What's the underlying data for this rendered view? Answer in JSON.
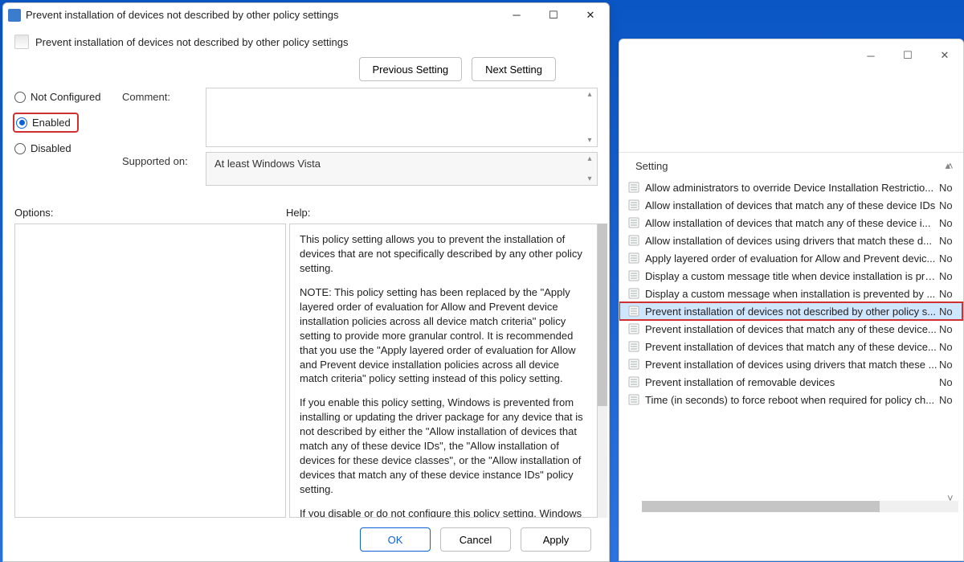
{
  "bg": {
    "header_setting": "Setting",
    "sort_indicator": "▴",
    "rows": [
      {
        "label": "Allow administrators to override Device Installation Restrictio...",
        "state": "No",
        "sel": false
      },
      {
        "label": "Allow installation of devices that match any of these device IDs",
        "state": "No",
        "sel": false
      },
      {
        "label": "Allow installation of devices that match any of these device i...",
        "state": "No",
        "sel": false
      },
      {
        "label": "Allow installation of devices using drivers that match these d...",
        "state": "No",
        "sel": false
      },
      {
        "label": "Apply layered order of evaluation for Allow and Prevent devic...",
        "state": "No",
        "sel": false
      },
      {
        "label": "Display a custom message title when device installation is pre...",
        "state": "No",
        "sel": false
      },
      {
        "label": "Display a custom message when installation is prevented by ...",
        "state": "No",
        "sel": false
      },
      {
        "label": "Prevent installation of devices not described by other policy s...",
        "state": "No",
        "sel": true
      },
      {
        "label": "Prevent installation of devices that match any of these device...",
        "state": "No",
        "sel": false
      },
      {
        "label": "Prevent installation of devices that match any of these device...",
        "state": "No",
        "sel": false
      },
      {
        "label": "Prevent installation of devices using drivers that match these ...",
        "state": "No",
        "sel": false
      },
      {
        "label": "Prevent installation of removable devices",
        "state": "No",
        "sel": false
      },
      {
        "label": "Time (in seconds) to force reboot when required for policy ch...",
        "state": "No",
        "sel": false
      }
    ]
  },
  "dlg": {
    "title": "Prevent installation of devices not described by other policy settings",
    "heading": "Prevent installation of devices not described by other policy settings",
    "nav": {
      "prev": "Previous Setting",
      "next": "Next Setting"
    },
    "radios": {
      "not_configured": "Not Configured",
      "enabled": "Enabled",
      "disabled": "Disabled"
    },
    "labels": {
      "comment": "Comment:",
      "supported": "Supported on:",
      "options": "Options:",
      "help": "Help:"
    },
    "supported_value": "At least Windows Vista",
    "help_paragraphs": [
      "This policy setting allows you to prevent the installation of devices that are not specifically described by any other policy setting.",
      "NOTE: This policy setting has been replaced by the \"Apply layered order of evaluation for Allow and Prevent device installation policies across all device match criteria\" policy setting to provide more granular control. It is recommended that you use the \"Apply layered order of evaluation for Allow and Prevent device installation policies across all device match criteria\" policy setting instead of this policy setting.",
      "If you enable this policy setting, Windows is prevented from installing or updating the driver package for any device that is not described by either the \"Allow installation of devices that match any of these device IDs\", the \"Allow installation of devices for these device classes\", or the \"Allow installation of devices that match any of these device instance IDs\" policy setting.",
      "If you disable or do not configure this policy setting, Windows is"
    ],
    "footer": {
      "ok": "OK",
      "cancel": "Cancel",
      "apply": "Apply"
    }
  }
}
